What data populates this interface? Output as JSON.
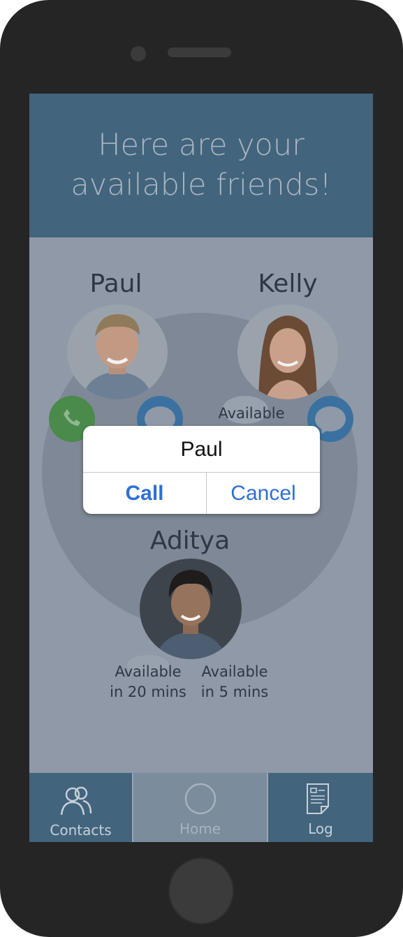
{
  "header": {
    "title_line1": "Here are your",
    "title_line2": "available friends!"
  },
  "friends": [
    {
      "name": "Paul",
      "status": ""
    },
    {
      "name": "Kelly",
      "status": "Available"
    },
    {
      "name": "Aditya",
      "status_left": "Available\nin 20 mins",
      "status_right": "Available\nin 5 mins"
    }
  ],
  "dialog": {
    "title": "Paul",
    "call_label": "Call",
    "cancel_label": "Cancel"
  },
  "tabs": [
    {
      "label": "Contacts",
      "icon": "contacts-icon"
    },
    {
      "label": "Home",
      "icon": "home-circle-icon"
    },
    {
      "label": "Log",
      "icon": "log-document-icon"
    }
  ],
  "colors": {
    "header": "#42647c",
    "screen_dim": "#8f99a8",
    "call_green": "#4a8a4a",
    "message_blue": "#3a71a0",
    "dialog_button": "#2f6fd6"
  }
}
